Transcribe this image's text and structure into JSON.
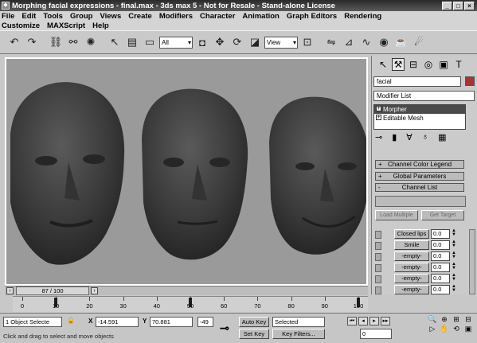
{
  "title_bar": {
    "title": "Morphing facial expressions - final.max - 3ds max 5 - Not for Resale - Stand-alone License",
    "buttons": [
      "_",
      "□",
      "×"
    ]
  },
  "menu": {
    "row1": [
      "File",
      "Edit",
      "Tools",
      "Group",
      "Views",
      "Create",
      "Modifiers",
      "Character",
      "Animation",
      "Graph Editors",
      "Rendering"
    ],
    "row2": [
      "Customize",
      "MAXScript",
      "Help"
    ]
  },
  "toolbar": {
    "selection_filter": "All",
    "reference_coord": "View"
  },
  "command_panel": {
    "object_name": "facial",
    "modifier_list": "Modifier List",
    "stack": [
      {
        "label": "Morpher",
        "selected": true
      },
      {
        "label": "Editable Mesh",
        "selected": false
      }
    ],
    "rollouts": {
      "channel_color_legend": "Channel Color Legend",
      "global_parameters": "Global Parameters",
      "channel_list": "Channel List"
    },
    "load_multiple": "Load Multiple",
    "get_from_scene": "Get Target",
    "channels": [
      {
        "name": "Closed lips",
        "value": "0.0",
        "active": true
      },
      {
        "name": "Smile",
        "value": "0.0",
        "active": true
      },
      {
        "name": "-empty-",
        "value": "0.0",
        "active": false
      },
      {
        "name": "-empty-",
        "value": "0.0",
        "active": false
      },
      {
        "name": "-empty-",
        "value": "0.0",
        "active": false
      },
      {
        "name": "-empty-",
        "value": "0.0",
        "active": false
      },
      {
        "name": "-empty-",
        "value": "0.0",
        "active": false
      }
    ]
  },
  "time_slider": {
    "label": "87 / 100",
    "current_frame": 87,
    "total_frames": 100
  },
  "track_bar": {
    "ticks": [
      0,
      10,
      20,
      30,
      40,
      50,
      60,
      70,
      80,
      90,
      100
    ],
    "keys": [
      10,
      50,
      100
    ]
  },
  "status": {
    "selection": "1 Object Selecte",
    "x_label": "X",
    "x_value": "-14.591",
    "y_label": "Y",
    "y_value": "70.881",
    "z_value": "-49",
    "auto_key": "Auto Key",
    "set_key": "Set Key",
    "key_mode": "Selected",
    "key_filters": "Key Filters...",
    "current_frame": "0",
    "prompt": "Click and drag to select and move objects"
  },
  "colors": {
    "title_bar": "#3a3a3a",
    "viewport_bg": "#9a9a9a",
    "head": "#3c3c3c",
    "object_color": "#aa3333"
  }
}
